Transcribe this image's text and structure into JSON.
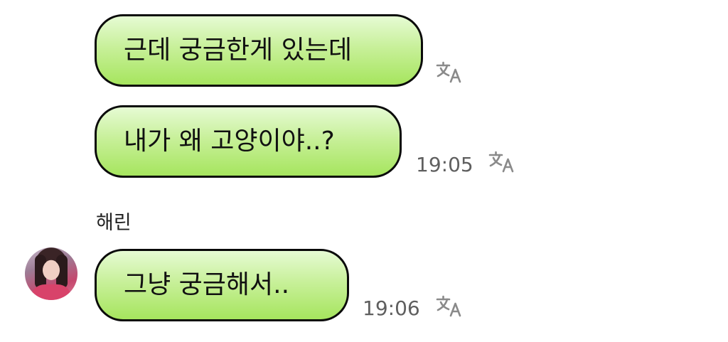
{
  "messages": {
    "sent_1": {
      "text": "근데 궁금한게 있는데"
    },
    "sent_2": {
      "text": "내가 왜 고양이야..?",
      "time": "19:05"
    },
    "received_1": {
      "sender": "해린",
      "text": "그냥 궁금해서..",
      "time": "19:06"
    }
  },
  "icons": {
    "translate": "translate-icon",
    "avatar": "avatar"
  },
  "colors": {
    "bubble_top": "#e6fbd4",
    "bubble_bottom": "#a6e55e",
    "bubble_border": "#0a0a0a",
    "timestamp": "#5f5f5f",
    "icon": "#8a8a8a"
  }
}
